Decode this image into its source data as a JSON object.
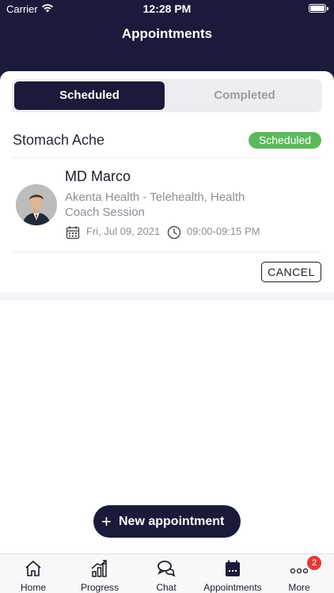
{
  "status_bar": {
    "carrier": "Carrier",
    "time": "12:28 PM"
  },
  "header": {
    "title": "Appointments"
  },
  "tabs": {
    "scheduled": "Scheduled",
    "completed": "Completed"
  },
  "appointment": {
    "title": "Stomach Ache",
    "status": "Scheduled",
    "doctor": "MD Marco",
    "service": "Akenta Health - Telehealth, Health Coach Session",
    "date": "Fri, Jul 09, 2021",
    "time": "09:00-09:15 PM",
    "cancel_label": "CANCEL"
  },
  "fab": {
    "label": "New appointment"
  },
  "tabbar": {
    "items": [
      {
        "label": "Home",
        "icon": "home-icon"
      },
      {
        "label": "Progress",
        "icon": "progress-icon"
      },
      {
        "label": "Chat",
        "icon": "chat-icon"
      },
      {
        "label": "Appointments",
        "icon": "calendar-icon"
      },
      {
        "label": "More",
        "icon": "more-icon"
      }
    ],
    "more_badge": "2"
  },
  "colors": {
    "header": "#1a1a3a",
    "status_badge": "#5cb85c",
    "notification": "#e53935"
  }
}
